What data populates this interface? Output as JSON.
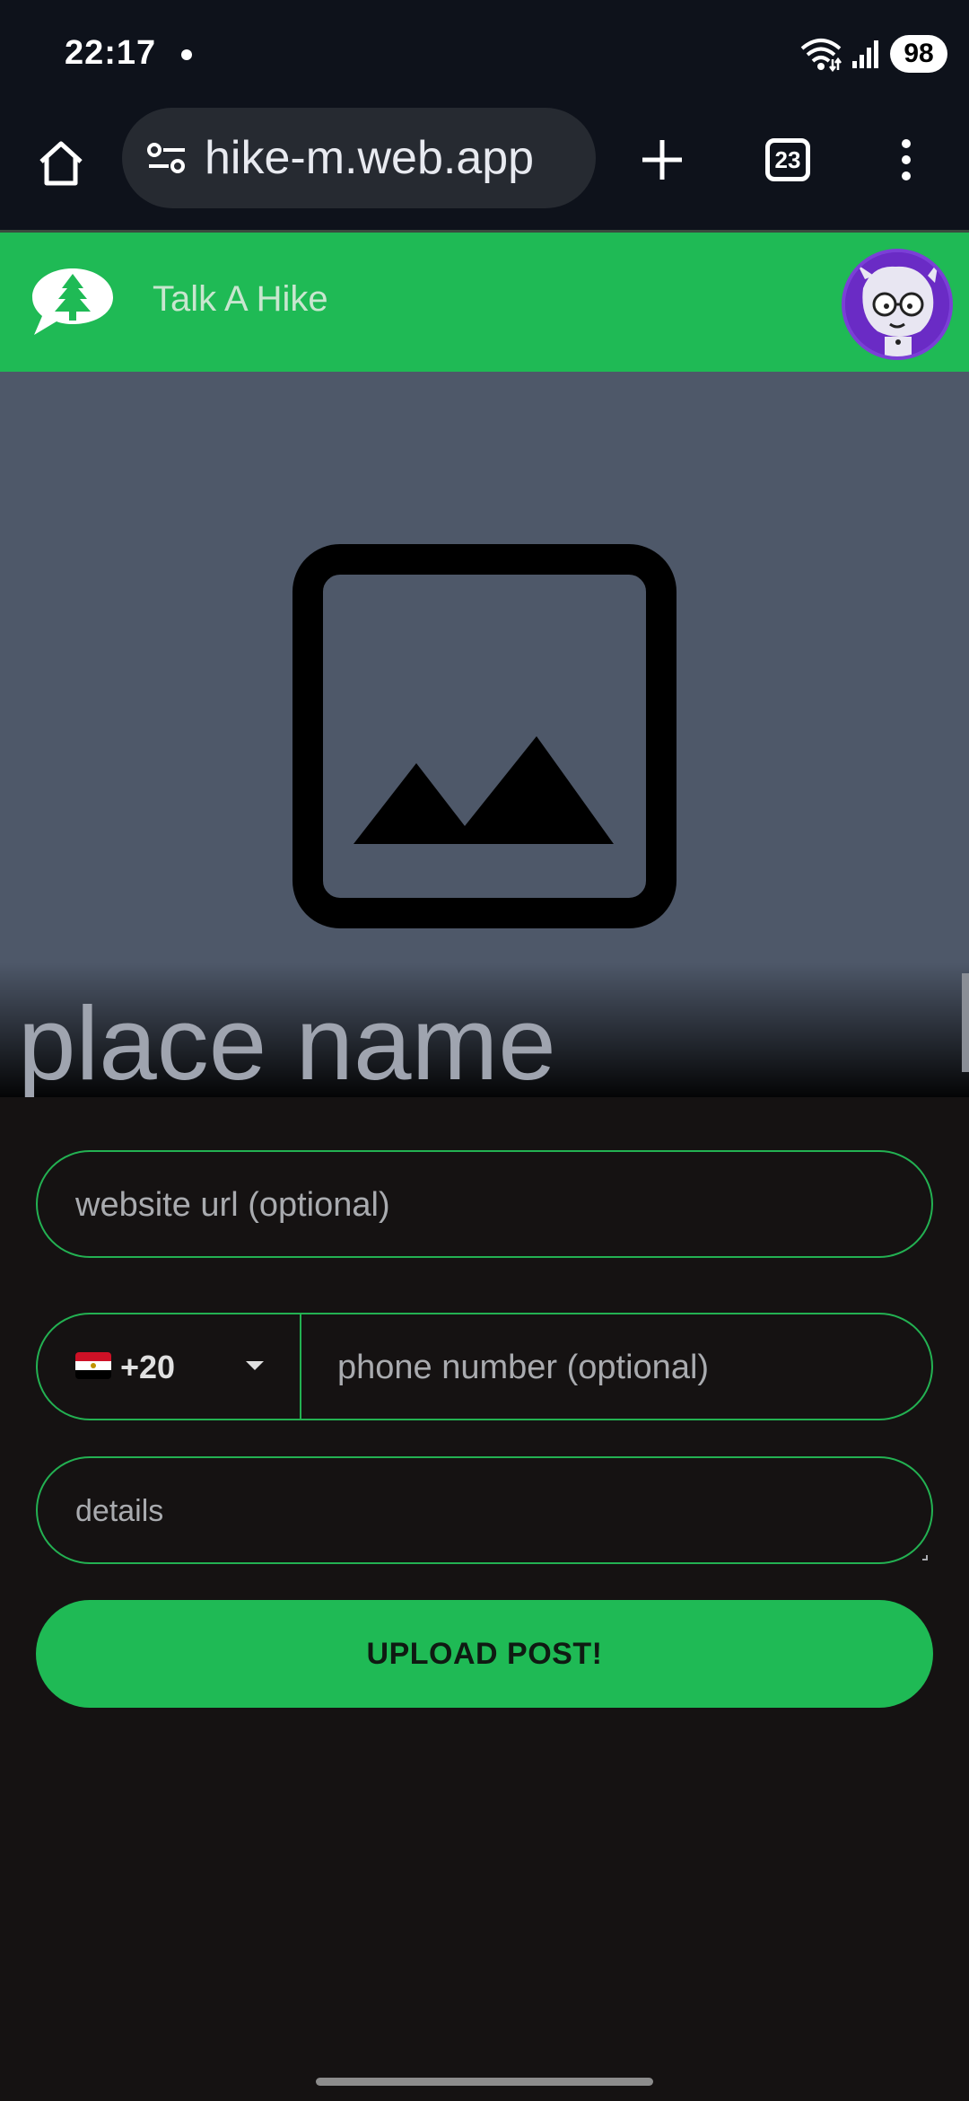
{
  "status_bar": {
    "time": "22:17",
    "battery": "98"
  },
  "browser": {
    "url": "hike-m.web.app",
    "tab_count": "23"
  },
  "app": {
    "title": "Talk A Hike",
    "brand_color": "#1fba55"
  },
  "hero": {
    "place_name_placeholder": "place name"
  },
  "form": {
    "website_placeholder": "website url (optional)",
    "country_dial_code": "+20",
    "phone_placeholder": "phone number (optional)",
    "details_placeholder": "details",
    "submit_label": "UPLOAD POST!"
  }
}
